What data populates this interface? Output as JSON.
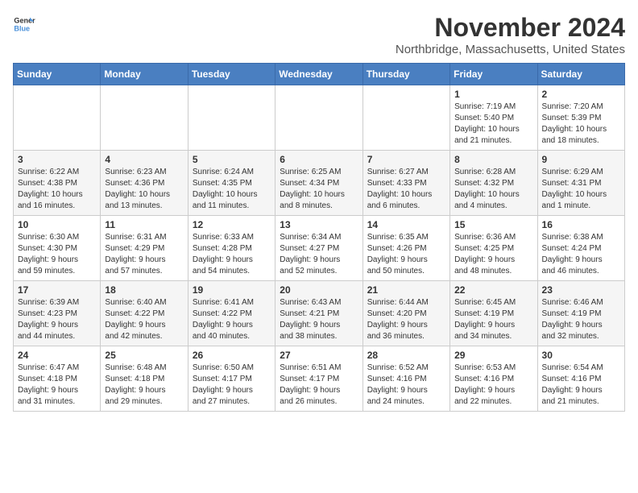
{
  "header": {
    "logo_general": "General",
    "logo_blue": "Blue",
    "month": "November 2024",
    "location": "Northbridge, Massachusetts, United States"
  },
  "weekdays": [
    "Sunday",
    "Monday",
    "Tuesday",
    "Wednesday",
    "Thursday",
    "Friday",
    "Saturday"
  ],
  "weeks": [
    [
      {
        "day": "",
        "info": ""
      },
      {
        "day": "",
        "info": ""
      },
      {
        "day": "",
        "info": ""
      },
      {
        "day": "",
        "info": ""
      },
      {
        "day": "",
        "info": ""
      },
      {
        "day": "1",
        "info": "Sunrise: 7:19 AM\nSunset: 5:40 PM\nDaylight: 10 hours\nand 21 minutes."
      },
      {
        "day": "2",
        "info": "Sunrise: 7:20 AM\nSunset: 5:39 PM\nDaylight: 10 hours\nand 18 minutes."
      }
    ],
    [
      {
        "day": "3",
        "info": "Sunrise: 6:22 AM\nSunset: 4:38 PM\nDaylight: 10 hours\nand 16 minutes."
      },
      {
        "day": "4",
        "info": "Sunrise: 6:23 AM\nSunset: 4:36 PM\nDaylight: 10 hours\nand 13 minutes."
      },
      {
        "day": "5",
        "info": "Sunrise: 6:24 AM\nSunset: 4:35 PM\nDaylight: 10 hours\nand 11 minutes."
      },
      {
        "day": "6",
        "info": "Sunrise: 6:25 AM\nSunset: 4:34 PM\nDaylight: 10 hours\nand 8 minutes."
      },
      {
        "day": "7",
        "info": "Sunrise: 6:27 AM\nSunset: 4:33 PM\nDaylight: 10 hours\nand 6 minutes."
      },
      {
        "day": "8",
        "info": "Sunrise: 6:28 AM\nSunset: 4:32 PM\nDaylight: 10 hours\nand 4 minutes."
      },
      {
        "day": "9",
        "info": "Sunrise: 6:29 AM\nSunset: 4:31 PM\nDaylight: 10 hours\nand 1 minute."
      }
    ],
    [
      {
        "day": "10",
        "info": "Sunrise: 6:30 AM\nSunset: 4:30 PM\nDaylight: 9 hours\nand 59 minutes."
      },
      {
        "day": "11",
        "info": "Sunrise: 6:31 AM\nSunset: 4:29 PM\nDaylight: 9 hours\nand 57 minutes."
      },
      {
        "day": "12",
        "info": "Sunrise: 6:33 AM\nSunset: 4:28 PM\nDaylight: 9 hours\nand 54 minutes."
      },
      {
        "day": "13",
        "info": "Sunrise: 6:34 AM\nSunset: 4:27 PM\nDaylight: 9 hours\nand 52 minutes."
      },
      {
        "day": "14",
        "info": "Sunrise: 6:35 AM\nSunset: 4:26 PM\nDaylight: 9 hours\nand 50 minutes."
      },
      {
        "day": "15",
        "info": "Sunrise: 6:36 AM\nSunset: 4:25 PM\nDaylight: 9 hours\nand 48 minutes."
      },
      {
        "day": "16",
        "info": "Sunrise: 6:38 AM\nSunset: 4:24 PM\nDaylight: 9 hours\nand 46 minutes."
      }
    ],
    [
      {
        "day": "17",
        "info": "Sunrise: 6:39 AM\nSunset: 4:23 PM\nDaylight: 9 hours\nand 44 minutes."
      },
      {
        "day": "18",
        "info": "Sunrise: 6:40 AM\nSunset: 4:22 PM\nDaylight: 9 hours\nand 42 minutes."
      },
      {
        "day": "19",
        "info": "Sunrise: 6:41 AM\nSunset: 4:22 PM\nDaylight: 9 hours\nand 40 minutes."
      },
      {
        "day": "20",
        "info": "Sunrise: 6:43 AM\nSunset: 4:21 PM\nDaylight: 9 hours\nand 38 minutes."
      },
      {
        "day": "21",
        "info": "Sunrise: 6:44 AM\nSunset: 4:20 PM\nDaylight: 9 hours\nand 36 minutes."
      },
      {
        "day": "22",
        "info": "Sunrise: 6:45 AM\nSunset: 4:19 PM\nDaylight: 9 hours\nand 34 minutes."
      },
      {
        "day": "23",
        "info": "Sunrise: 6:46 AM\nSunset: 4:19 PM\nDaylight: 9 hours\nand 32 minutes."
      }
    ],
    [
      {
        "day": "24",
        "info": "Sunrise: 6:47 AM\nSunset: 4:18 PM\nDaylight: 9 hours\nand 31 minutes."
      },
      {
        "day": "25",
        "info": "Sunrise: 6:48 AM\nSunset: 4:18 PM\nDaylight: 9 hours\nand 29 minutes."
      },
      {
        "day": "26",
        "info": "Sunrise: 6:50 AM\nSunset: 4:17 PM\nDaylight: 9 hours\nand 27 minutes."
      },
      {
        "day": "27",
        "info": "Sunrise: 6:51 AM\nSunset: 4:17 PM\nDaylight: 9 hours\nand 26 minutes."
      },
      {
        "day": "28",
        "info": "Sunrise: 6:52 AM\nSunset: 4:16 PM\nDaylight: 9 hours\nand 24 minutes."
      },
      {
        "day": "29",
        "info": "Sunrise: 6:53 AM\nSunset: 4:16 PM\nDaylight: 9 hours\nand 22 minutes."
      },
      {
        "day": "30",
        "info": "Sunrise: 6:54 AM\nSunset: 4:16 PM\nDaylight: 9 hours\nand 21 minutes."
      }
    ]
  ]
}
